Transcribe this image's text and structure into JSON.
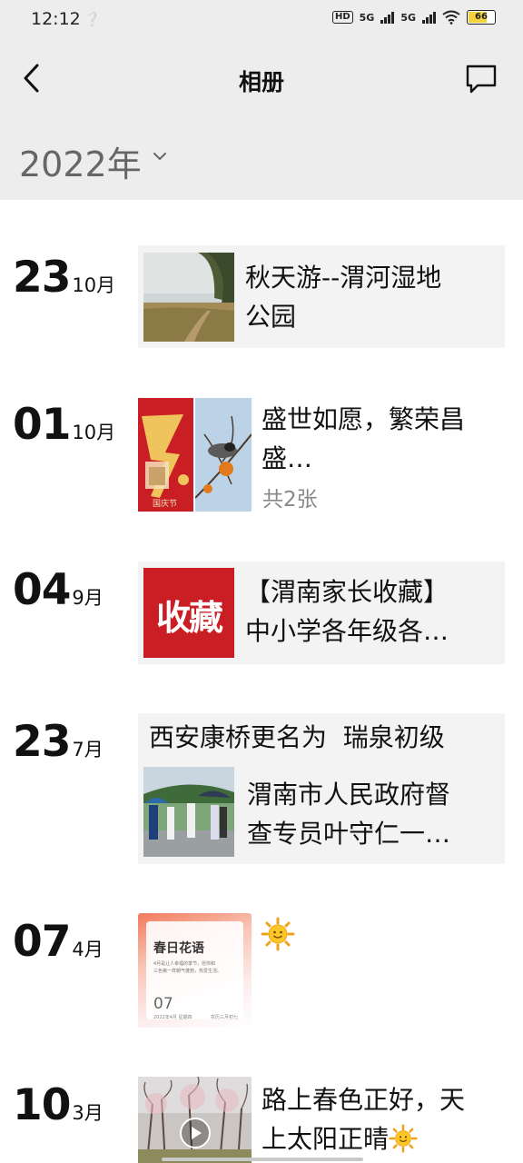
{
  "status_bar": {
    "time": "12:12",
    "hd_label": "HD",
    "network_1": "5G",
    "network_2": "5G",
    "battery": "66"
  },
  "header": {
    "title": "相册",
    "back_icon": "chevron-left-icon",
    "message_icon": "speech-bubble-icon"
  },
  "year_selector": {
    "label": "2022年",
    "caret_icon": "chevron-down-icon"
  },
  "entries": [
    {
      "day": "23",
      "month": "10月",
      "title": "秋天游--渭河湿地公园",
      "title_lines": [
        "秋天游--渭河湿地",
        "公园"
      ],
      "thumbnail": "wetland-path-photo"
    },
    {
      "day": "01",
      "month": "10月",
      "title": "盛世如愿，繁荣昌盛…",
      "title_lines": [
        "盛世如愿，繁荣昌",
        "盛…"
      ],
      "count_label": "共2张",
      "thumbnails": [
        "national-day-73-poster",
        "bird-on-persimmon-branch-photo"
      ],
      "poster_caption": "国庆节"
    },
    {
      "day": "04",
      "month": "9月",
      "title": "【渭南家长收藏】中小学各年级各…",
      "title_lines": [
        "【渭南家长收藏】",
        "中小学各年级各…"
      ],
      "thumbnail_text": "收藏"
    },
    {
      "day": "23",
      "month": "7月",
      "headline": "西安康桥更名为  瑞泉初级",
      "title": "渭南市人民政府督查专员叶守仁一…",
      "title_lines": [
        "渭南市人民政府督",
        "查专员叶守仁一…"
      ],
      "thumbnail": "officials-with-umbrellas-photo"
    },
    {
      "day": "07",
      "month": "4月",
      "emoji_icon": "sun-emoji-icon",
      "card": {
        "title": "春日花语",
        "body_lines": [
          "4月是让人幸福的季节，愿你和",
          "三色第一样朝气蓬勃，热爱生活。"
        ],
        "date_num": "07",
        "date_sub": "2022年4月 星期四",
        "lunar": "农历三月初七"
      }
    },
    {
      "day": "10",
      "month": "3月",
      "title": "路上春色正好，天上太阳正晴",
      "title_lines": [
        "路上春色正好，天",
        "上太阳正晴"
      ],
      "thumbnail": "blossom-trees-video",
      "play_icon": "play-icon",
      "emoji_icon": "sun-emoji-icon"
    }
  ],
  "colors": {
    "header_bg": "#ededed",
    "card_bg": "#f3f3f3",
    "accent_red": "#c81e24",
    "battery_yellow": "#f4d23b"
  }
}
